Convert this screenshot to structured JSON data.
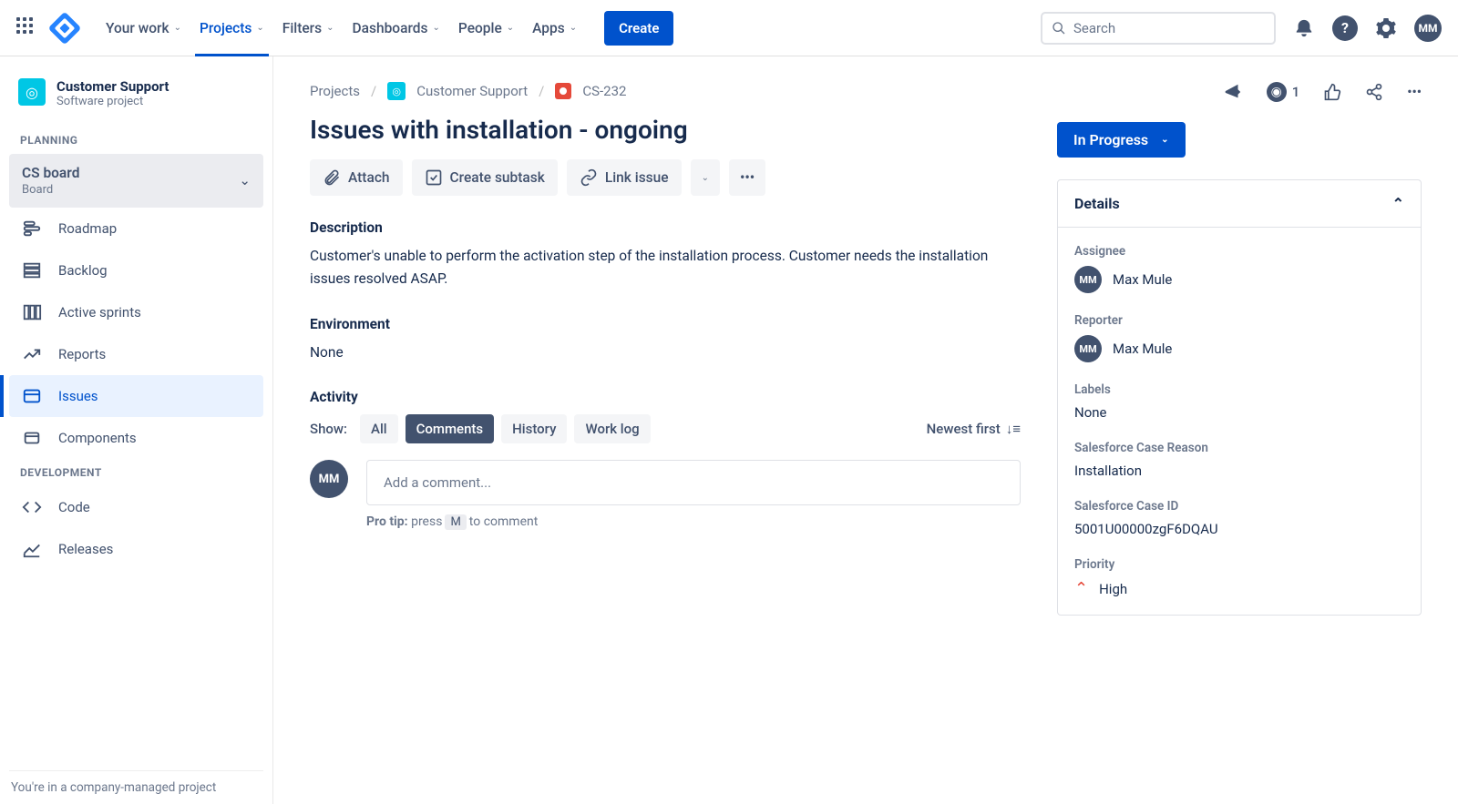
{
  "nav": {
    "items": [
      "Your work",
      "Projects",
      "Filters",
      "Dashboards",
      "People",
      "Apps"
    ],
    "active_index": 1,
    "create": "Create",
    "search_placeholder": "Search",
    "avatar": "MM"
  },
  "sidebar": {
    "project_name": "Customer Support",
    "project_type": "Software project",
    "section_planning": "PLANNING",
    "board_name": "CS board",
    "board_sub": "Board",
    "items_planning": [
      "Roadmap",
      "Backlog",
      "Active sprints",
      "Reports",
      "Issues",
      "Components"
    ],
    "active_item": "Issues",
    "section_dev": "DEVELOPMENT",
    "items_dev": [
      "Code",
      "Releases"
    ],
    "footer": "You're in a company-managed project"
  },
  "issue": {
    "crumb_projects": "Projects",
    "crumb_project": "Customer Support",
    "crumb_key": "CS-232",
    "title": "Issues with installation - ongoing",
    "actions": {
      "attach": "Attach",
      "subtask": "Create subtask",
      "link": "Link issue"
    },
    "desc_label": "Description",
    "desc_text": "Customer's unable to perform the activation step of the installation process. Customer needs the installation issues resolved ASAP.",
    "env_label": "Environment",
    "env_text": "None",
    "activity_label": "Activity",
    "show_label": "Show:",
    "tabs": [
      "All",
      "Comments",
      "History",
      "Work log"
    ],
    "tab_active": "Comments",
    "newest": "Newest first",
    "comment_placeholder": "Add a comment...",
    "protip_bold": "Pro tip:",
    "protip_press": "press",
    "protip_key": "M",
    "protip_rest": "to comment",
    "watch_count": "1"
  },
  "details": {
    "status": "In Progress",
    "panel_title": "Details",
    "assignee_label": "Assignee",
    "assignee": "Max Mule",
    "assignee_initials": "MM",
    "reporter_label": "Reporter",
    "reporter": "Max Mule",
    "reporter_initials": "MM",
    "labels_label": "Labels",
    "labels": "None",
    "reason_label": "Salesforce Case Reason",
    "reason": "Installation",
    "caseid_label": "Salesforce Case ID",
    "caseid": "5001U00000zgF6DQAU",
    "priority_label": "Priority",
    "priority": "High"
  }
}
